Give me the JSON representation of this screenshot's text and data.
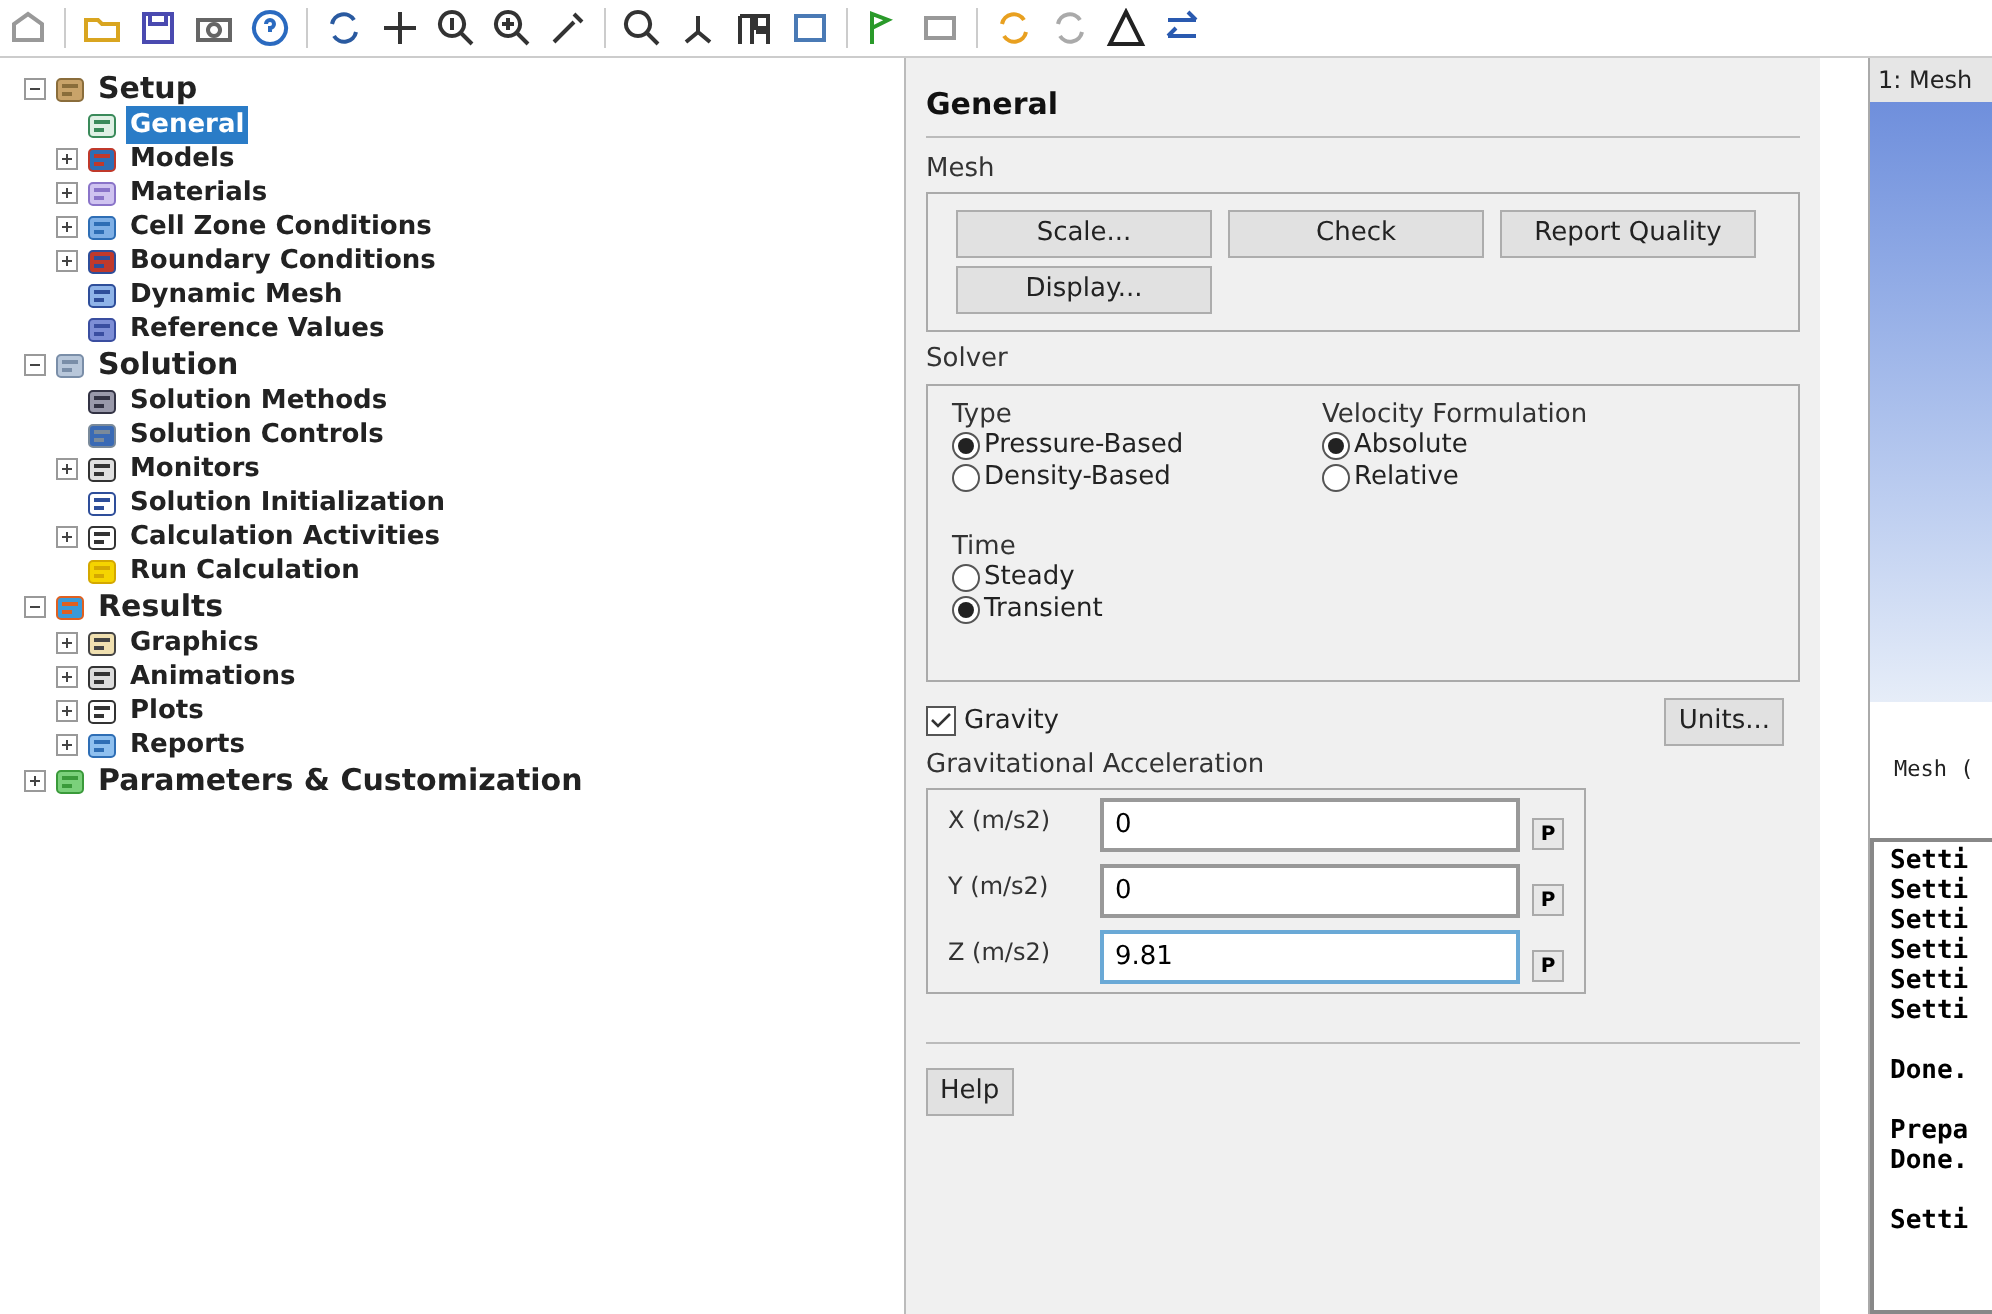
{
  "tree": [
    {
      "label": "Setup",
      "expanded": true,
      "selected": false,
      "children": [
        {
          "label": "General",
          "selected": true
        },
        {
          "label": "Models",
          "expanded": false,
          "selected": false
        },
        {
          "label": "Materials",
          "expanded": false,
          "selected": false
        },
        {
          "label": "Cell Zone Conditions",
          "expanded": false,
          "selected": false
        },
        {
          "label": "Boundary Conditions",
          "expanded": false,
          "selected": false
        },
        {
          "label": "Dynamic Mesh",
          "selected": false
        },
        {
          "label": "Reference Values",
          "selected": false
        }
      ]
    },
    {
      "label": "Solution",
      "expanded": true,
      "selected": false,
      "children": [
        {
          "label": "Solution Methods",
          "selected": false
        },
        {
          "label": "Solution Controls",
          "selected": false
        },
        {
          "label": "Monitors",
          "expanded": false,
          "selected": false
        },
        {
          "label": "Solution Initialization",
          "selected": false
        },
        {
          "label": "Calculation Activities",
          "expanded": false,
          "selected": false
        },
        {
          "label": "Run Calculation",
          "selected": false
        }
      ]
    },
    {
      "label": "Results",
      "expanded": true,
      "selected": false,
      "children": [
        {
          "label": "Graphics",
          "expanded": false,
          "selected": false
        },
        {
          "label": "Animations",
          "expanded": false,
          "selected": false
        },
        {
          "label": "Plots",
          "expanded": false,
          "selected": false
        },
        {
          "label": "Reports",
          "expanded": false,
          "selected": false
        }
      ]
    },
    {
      "label": "Parameters & Customization",
      "expanded": false,
      "selected": false
    }
  ],
  "panel": {
    "title": "General",
    "mesh": {
      "label": "Mesh",
      "buttons": [
        "Scale...",
        "Check",
        "Report Quality",
        "Display..."
      ]
    },
    "solver": {
      "label": "Solver",
      "groups": [
        {
          "label": "Type",
          "options": [
            {
              "label": "Pressure-Based",
              "selected": true
            },
            {
              "label": "Density-Based",
              "selected": false
            }
          ]
        },
        {
          "label": "Velocity Formulation",
          "options": [
            {
              "label": "Absolute",
              "selected": true
            },
            {
              "label": "Relative",
              "selected": false
            }
          ]
        },
        {
          "label": "Time",
          "options": [
            {
              "label": "Steady",
              "selected": false
            },
            {
              "label": "Transient",
              "selected": true
            }
          ]
        }
      ]
    },
    "gravity": {
      "label": "Gravity",
      "checked": true
    },
    "units_button": "Units...",
    "acceleration": {
      "label": "Gravitational Acceleration",
      "fields": [
        {
          "label": "X (m/s2)",
          "value": "0",
          "focused": false,
          "param": "P"
        },
        {
          "label": "Y (m/s2)",
          "value": "0",
          "focused": false,
          "param": "P"
        },
        {
          "label": "Z (m/s2)",
          "value": "9.81",
          "focused": true,
          "param": "P"
        }
      ]
    },
    "help_button": "Help"
  },
  "graphics": {
    "title": "1: Mesh",
    "caption": "Mesh ("
  },
  "console": [
    [
      "Setti",
      "Setti",
      "Setti",
      "Setti",
      "Setti",
      "Setti"
    ],
    [
      "Done."
    ],
    [
      "Prepa",
      "Done."
    ],
    [
      "Setti"
    ]
  ]
}
